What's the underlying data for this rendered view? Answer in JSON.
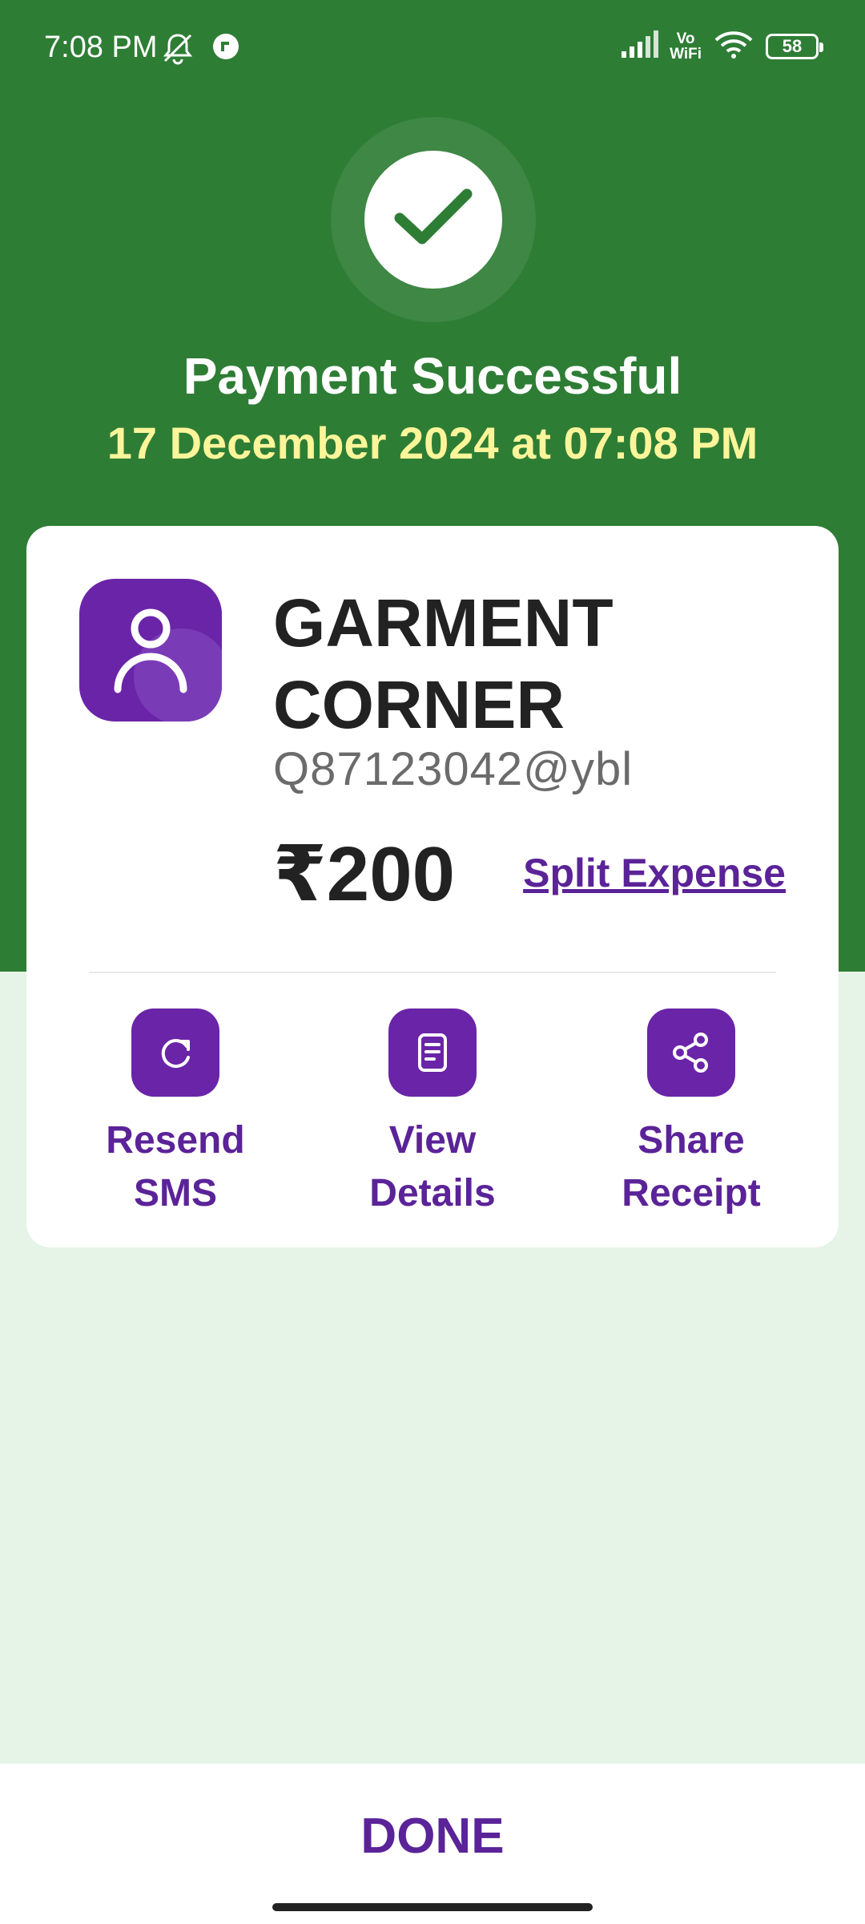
{
  "status_bar": {
    "time": "7:08 PM",
    "vowifi_top": "Vo",
    "vowifi_bottom": "WiFi",
    "battery": "58"
  },
  "header": {
    "title": "Payment Successful",
    "datetime": "17 December 2024 at 07:08 PM"
  },
  "payee": {
    "name": "GARMENT CORNER",
    "upi_id": "Q87123042@ybl",
    "amount": "₹200",
    "split_label": "Split Expense"
  },
  "actions": [
    {
      "label": "Resend SMS",
      "icon": "refresh-icon"
    },
    {
      "label": "View Details",
      "icon": "document-icon"
    },
    {
      "label": "Share Receipt",
      "icon": "share-icon"
    }
  ],
  "footer": {
    "done_label": "DONE"
  },
  "colors": {
    "header_green": "#2e7d35",
    "background_light_green": "#e6f4e7",
    "accent_purple": "#6a24a8",
    "date_yellow": "#fdf59a"
  }
}
